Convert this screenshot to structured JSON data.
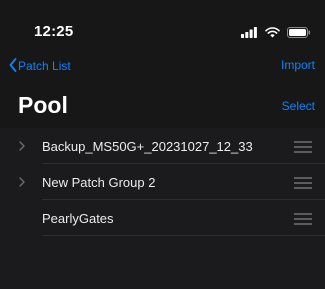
{
  "status_bar": {
    "time": "12:25"
  },
  "nav": {
    "back_label": "Patch List",
    "import_label": "Import"
  },
  "page": {
    "title": "Pool",
    "select_label": "Select"
  },
  "rows": [
    {
      "label": "Backup_MS50G+_20231027_12_33",
      "has_chevron": true
    },
    {
      "label": "New Patch Group 2",
      "has_chevron": true
    },
    {
      "label": "PearlyGates",
      "has_chevron": false
    }
  ],
  "colors": {
    "accent": "#0a84ff",
    "background": "#000000",
    "list_bg": "#1b1b1d"
  }
}
